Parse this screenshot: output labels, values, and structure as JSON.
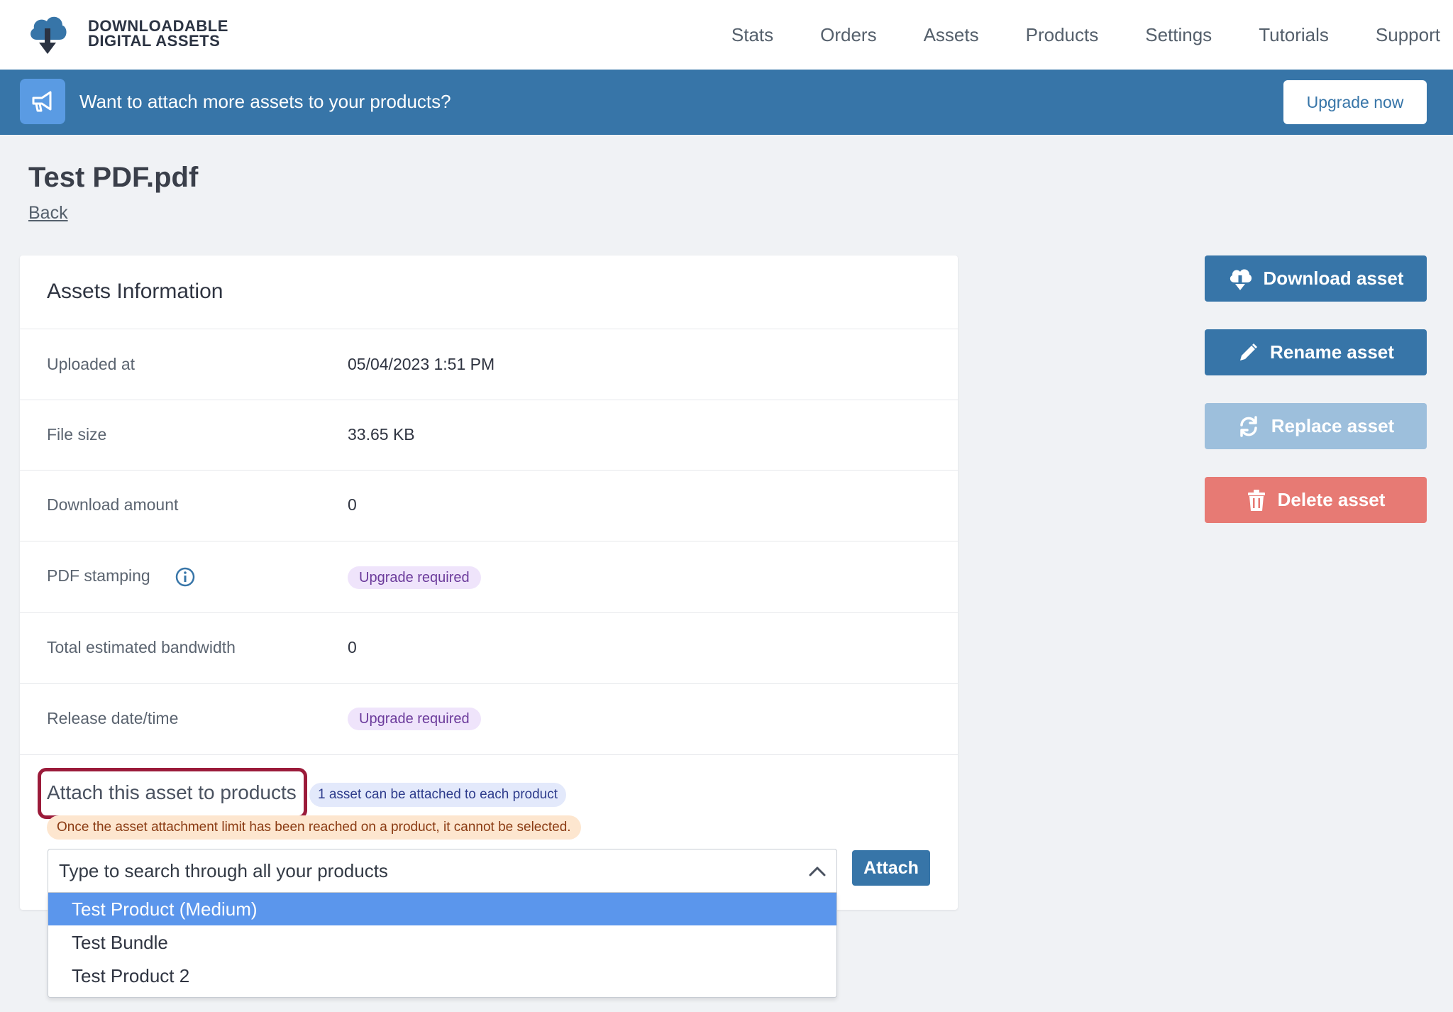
{
  "brand": {
    "line1": "DOWNLOADABLE",
    "line2": "DIGITAL ASSETS",
    "icon": "cloud-download-icon"
  },
  "nav": {
    "items": [
      "Stats",
      "Orders",
      "Assets",
      "Products",
      "Settings",
      "Tutorials",
      "Support"
    ]
  },
  "banner": {
    "text": "Want to attach more assets to your products?",
    "button": "Upgrade now",
    "icon": "megaphone-icon"
  },
  "page": {
    "title": "Test PDF.pdf",
    "back": "Back"
  },
  "card": {
    "title": "Assets Information",
    "rows": [
      {
        "label": "Uploaded at",
        "value": "05/04/2023 1:51 PM"
      },
      {
        "label": "File size",
        "value": "33.65 KB"
      },
      {
        "label": "Download amount",
        "value": "0"
      },
      {
        "label": "PDF stamping",
        "value": "Upgrade required"
      },
      {
        "label": "Total estimated bandwidth",
        "value": "0"
      },
      {
        "label": "Release date/time",
        "value": "Upgrade required"
      }
    ],
    "attach": {
      "label": "Attach this asset to products",
      "limit_badge": "1 asset can be attached to each product",
      "warning": "Once the asset attachment limit has been reached on a product, it cannot be selected.",
      "search_placeholder": "Type to search through all your products",
      "button": "Attach",
      "options": [
        "Test Product (Medium)",
        "Test Bundle",
        "Test Product 2"
      ],
      "selected_index": 0
    }
  },
  "actions": {
    "download": "Download asset",
    "rename": "Rename asset",
    "replace": "Replace asset",
    "delete": "Delete asset"
  },
  "colors": {
    "primary": "#3775a8",
    "primary_disabled": "#9dbfdc",
    "danger": "#e77a74",
    "highlight_border": "#9b1b3a",
    "selected_option": "#5b96ec"
  }
}
